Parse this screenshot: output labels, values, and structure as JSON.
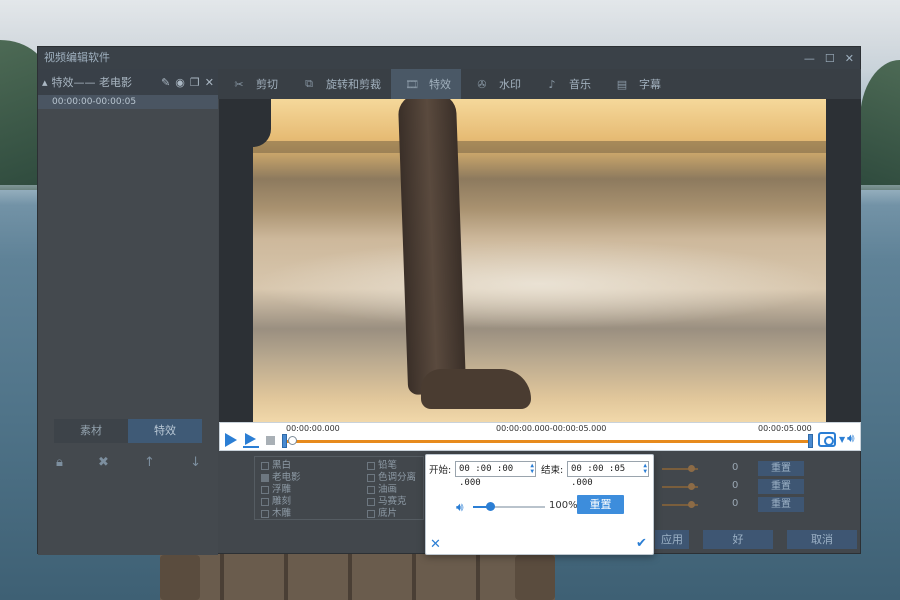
{
  "window": {
    "title": "视频编辑软件",
    "controls": [
      "—",
      "☐",
      "✕"
    ]
  },
  "left_panel": {
    "header_title": "特效—— 老电影",
    "clip_time": "00:00:00-00:00:05",
    "tabs": [
      {
        "label": "素材"
      },
      {
        "label": "特效"
      }
    ],
    "icons": [
      "lock-icon",
      "delete-icon",
      "up-icon",
      "down-icon"
    ]
  },
  "toolbar": {
    "items": [
      {
        "label": "剪切",
        "icon": "scissors-icon"
      },
      {
        "label": "旋转和剪裁",
        "icon": "crop-icon"
      },
      {
        "label": "特效",
        "icon": "film-effect-icon"
      },
      {
        "label": "水印",
        "icon": "watermark-icon"
      },
      {
        "label": "音乐",
        "icon": "music-icon"
      },
      {
        "label": "字幕",
        "icon": "subtitle-icon"
      }
    ],
    "active": "特效"
  },
  "timeline": {
    "start_time": "00:00:00.000",
    "range_text": "00:00:00.000-00:00:05.000",
    "end_time": "00:00:05.000"
  },
  "effects": {
    "col1": [
      {
        "label": "黑白",
        "checked": false
      },
      {
        "label": "老电影",
        "checked": true
      },
      {
        "label": "浮雕",
        "checked": false
      },
      {
        "label": "雕刻",
        "checked": false
      },
      {
        "label": "木雕",
        "checked": false
      }
    ],
    "col2": [
      {
        "label": "铅笔",
        "checked": false
      },
      {
        "label": "色调分离",
        "checked": false
      },
      {
        "label": "油画",
        "checked": false
      },
      {
        "label": "马赛克",
        "checked": false
      },
      {
        "label": "底片",
        "checked": false
      }
    ]
  },
  "right_sliders": [
    {
      "value": "0",
      "reset": "重置"
    },
    {
      "value": "0",
      "reset": "重置"
    },
    {
      "value": "0",
      "reset": "重置"
    }
  ],
  "bottom_buttons": {
    "apply": "应用",
    "ok": "好",
    "cancel": "取消"
  },
  "popup": {
    "start_label": "开始:",
    "start_value": "00 :00 :00 .000",
    "end_label": "结束:",
    "end_value": "00 :00 :05 .000",
    "volume_percent": "100%",
    "volume_level": 1.0,
    "reset_label": "重置",
    "close_icon": "close-icon",
    "ok_icon": "check-icon"
  },
  "colors": {
    "accent": "#2b7ed4",
    "progress": "#e78a1c",
    "window_bg": "#42474c"
  }
}
